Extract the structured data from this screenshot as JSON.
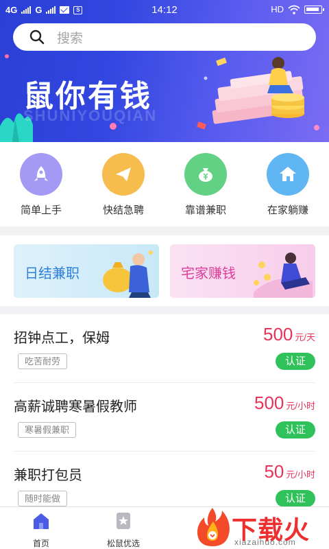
{
  "status_bar": {
    "network_1": "4G",
    "network_2": "G",
    "time": "14:12",
    "hd": "HD",
    "screen_icon_glyph": "S"
  },
  "search": {
    "placeholder": "搜索"
  },
  "banner": {
    "title": "鼠你有钱",
    "subtitle": "SHUNIYOUQIAN"
  },
  "categories": [
    {
      "label": "简单上手",
      "icon": "rocket-icon",
      "color": "#9f93f5"
    },
    {
      "label": "快结急聘",
      "icon": "paper-plane-icon",
      "color": "#f6bc4d"
    },
    {
      "label": "靠谱兼职",
      "icon": "money-bag-icon",
      "color": "#62d184"
    },
    {
      "label": "在家躺赚",
      "icon": "house-icon",
      "color": "#5fb6f2"
    }
  ],
  "promos": [
    {
      "label": "日结兼职",
      "color": "#2f7fd6"
    },
    {
      "label": "宅家赚钱",
      "color": "#dc3e9a"
    }
  ],
  "jobs": [
    {
      "title": "招钟点工，保姆",
      "tag": "吃苦耐劳",
      "price": "500",
      "unit": "元/天",
      "badge": "认证"
    },
    {
      "title": "高薪诚聘寒暑假教师",
      "tag": "寒暑假兼职",
      "price": "500",
      "unit": "元/小时",
      "badge": "认证"
    },
    {
      "title": "兼职打包员",
      "tag": "随时能做",
      "price": "50",
      "unit": "元/小时",
      "badge": "认证"
    }
  ],
  "tabbar": [
    {
      "label": "首页",
      "icon": "home-icon",
      "active": true
    },
    {
      "label": "松鼠优选",
      "icon": "star-icon",
      "active": false
    }
  ],
  "watermark": {
    "text": "下载火",
    "url": "xiazaihuo.com"
  },
  "colors": {
    "accent": "#3347e0",
    "price": "#e6335a",
    "badge": "#2fc25b"
  }
}
